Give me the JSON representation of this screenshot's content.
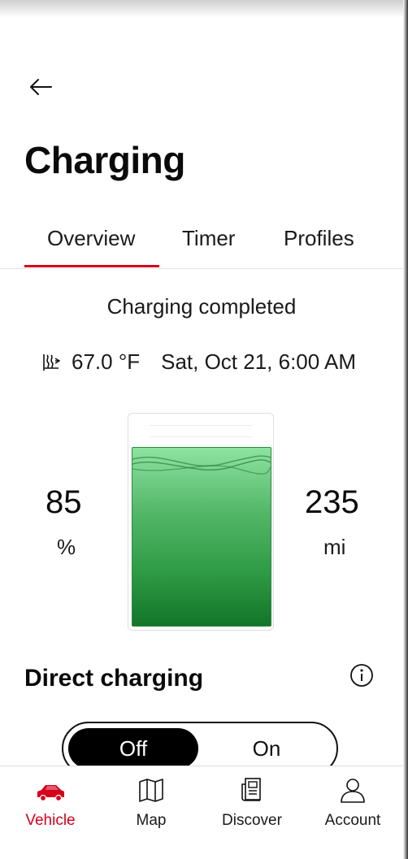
{
  "header": {
    "title": "Charging"
  },
  "tabs": [
    {
      "label": "Overview",
      "active": true
    },
    {
      "label": "Timer",
      "active": false
    },
    {
      "label": "Profiles",
      "active": false
    }
  ],
  "status": {
    "text": "Charging completed",
    "temperature": "67.0 °F",
    "datetime": "Sat, Oct 21, 6:00 AM",
    "climate_icon": "climate-heat-icon"
  },
  "battery": {
    "soc_value": "85",
    "soc_unit": "%",
    "soc_fraction": 0.85,
    "range_value": "235",
    "range_unit": "mi",
    "fill_color": "#2e9b45"
  },
  "direct_charging": {
    "title": "Direct charging",
    "info_icon": "info-icon",
    "options": [
      "Off",
      "On"
    ],
    "selected": "Off"
  },
  "bottom_nav": [
    {
      "label": "Vehicle",
      "icon": "car-icon",
      "active": true
    },
    {
      "label": "Map",
      "icon": "map-icon",
      "active": false
    },
    {
      "label": "Discover",
      "icon": "discover-icon",
      "active": false
    },
    {
      "label": "Account",
      "icon": "account-icon",
      "active": false
    }
  ],
  "colors": {
    "accent": "#d5001c",
    "text": "#111111",
    "toggle_active_bg": "#000000"
  }
}
